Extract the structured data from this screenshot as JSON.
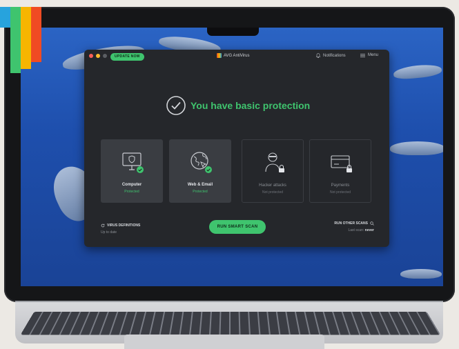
{
  "colors": {
    "accent_green": "#3fc46e",
    "window_bg": "#25272b",
    "tile_bg": "#3a3d42",
    "wallpaper_blue": "#1e4fad"
  },
  "titlebar": {
    "update_label": "UPDATE NOW",
    "app_title": "AVG AntiVirus",
    "notifications_label": "Notifications",
    "menu_label": "Menu"
  },
  "status": {
    "headline": "You have basic protection",
    "icon": "check-circle-icon"
  },
  "tiles": [
    {
      "name": "Computer",
      "status": "Protected",
      "icon": "monitor-shield-icon"
    },
    {
      "name": "Web & Email",
      "status": "Protected",
      "icon": "globe-cursor-icon"
    },
    {
      "name": "Hacker attacks",
      "status": "Not protected",
      "icon": "hacker-lock-icon"
    },
    {
      "name": "Payments",
      "status": "Not protected",
      "icon": "card-lock-icon"
    }
  ],
  "virus_definitions": {
    "title": "VIRUS DEFINITIONS",
    "status": "Up to date"
  },
  "scan_button": {
    "label": "RUN SMART SCAN"
  },
  "other_scans": {
    "title": "RUN OTHER SCANS",
    "last_scan_label": "Last scan:",
    "last_scan_value": "never"
  }
}
